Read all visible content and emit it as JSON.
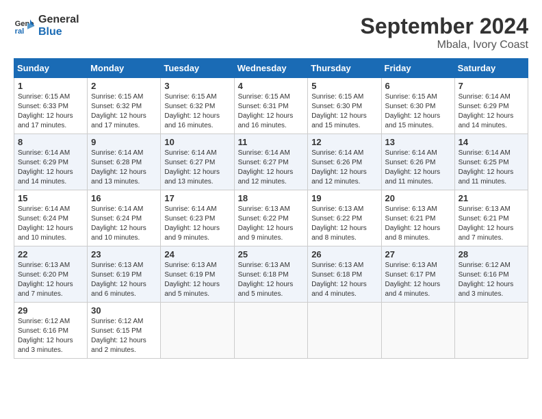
{
  "header": {
    "logo_line1": "General",
    "logo_line2": "Blue",
    "month": "September 2024",
    "location": "Mbala, Ivory Coast"
  },
  "weekdays": [
    "Sunday",
    "Monday",
    "Tuesday",
    "Wednesday",
    "Thursday",
    "Friday",
    "Saturday"
  ],
  "weeks": [
    [
      {
        "day": "1",
        "info": "Sunrise: 6:15 AM\nSunset: 6:33 PM\nDaylight: 12 hours\nand 17 minutes."
      },
      {
        "day": "2",
        "info": "Sunrise: 6:15 AM\nSunset: 6:32 PM\nDaylight: 12 hours\nand 17 minutes."
      },
      {
        "day": "3",
        "info": "Sunrise: 6:15 AM\nSunset: 6:32 PM\nDaylight: 12 hours\nand 16 minutes."
      },
      {
        "day": "4",
        "info": "Sunrise: 6:15 AM\nSunset: 6:31 PM\nDaylight: 12 hours\nand 16 minutes."
      },
      {
        "day": "5",
        "info": "Sunrise: 6:15 AM\nSunset: 6:30 PM\nDaylight: 12 hours\nand 15 minutes."
      },
      {
        "day": "6",
        "info": "Sunrise: 6:15 AM\nSunset: 6:30 PM\nDaylight: 12 hours\nand 15 minutes."
      },
      {
        "day": "7",
        "info": "Sunrise: 6:14 AM\nSunset: 6:29 PM\nDaylight: 12 hours\nand 14 minutes."
      }
    ],
    [
      {
        "day": "8",
        "info": "Sunrise: 6:14 AM\nSunset: 6:29 PM\nDaylight: 12 hours\nand 14 minutes."
      },
      {
        "day": "9",
        "info": "Sunrise: 6:14 AM\nSunset: 6:28 PM\nDaylight: 12 hours\nand 13 minutes."
      },
      {
        "day": "10",
        "info": "Sunrise: 6:14 AM\nSunset: 6:27 PM\nDaylight: 12 hours\nand 13 minutes."
      },
      {
        "day": "11",
        "info": "Sunrise: 6:14 AM\nSunset: 6:27 PM\nDaylight: 12 hours\nand 12 minutes."
      },
      {
        "day": "12",
        "info": "Sunrise: 6:14 AM\nSunset: 6:26 PM\nDaylight: 12 hours\nand 12 minutes."
      },
      {
        "day": "13",
        "info": "Sunrise: 6:14 AM\nSunset: 6:26 PM\nDaylight: 12 hours\nand 11 minutes."
      },
      {
        "day": "14",
        "info": "Sunrise: 6:14 AM\nSunset: 6:25 PM\nDaylight: 12 hours\nand 11 minutes."
      }
    ],
    [
      {
        "day": "15",
        "info": "Sunrise: 6:14 AM\nSunset: 6:24 PM\nDaylight: 12 hours\nand 10 minutes."
      },
      {
        "day": "16",
        "info": "Sunrise: 6:14 AM\nSunset: 6:24 PM\nDaylight: 12 hours\nand 10 minutes."
      },
      {
        "day": "17",
        "info": "Sunrise: 6:14 AM\nSunset: 6:23 PM\nDaylight: 12 hours\nand 9 minutes."
      },
      {
        "day": "18",
        "info": "Sunrise: 6:13 AM\nSunset: 6:22 PM\nDaylight: 12 hours\nand 9 minutes."
      },
      {
        "day": "19",
        "info": "Sunrise: 6:13 AM\nSunset: 6:22 PM\nDaylight: 12 hours\nand 8 minutes."
      },
      {
        "day": "20",
        "info": "Sunrise: 6:13 AM\nSunset: 6:21 PM\nDaylight: 12 hours\nand 8 minutes."
      },
      {
        "day": "21",
        "info": "Sunrise: 6:13 AM\nSunset: 6:21 PM\nDaylight: 12 hours\nand 7 minutes."
      }
    ],
    [
      {
        "day": "22",
        "info": "Sunrise: 6:13 AM\nSunset: 6:20 PM\nDaylight: 12 hours\nand 7 minutes."
      },
      {
        "day": "23",
        "info": "Sunrise: 6:13 AM\nSunset: 6:19 PM\nDaylight: 12 hours\nand 6 minutes."
      },
      {
        "day": "24",
        "info": "Sunrise: 6:13 AM\nSunset: 6:19 PM\nDaylight: 12 hours\nand 5 minutes."
      },
      {
        "day": "25",
        "info": "Sunrise: 6:13 AM\nSunset: 6:18 PM\nDaylight: 12 hours\nand 5 minutes."
      },
      {
        "day": "26",
        "info": "Sunrise: 6:13 AM\nSunset: 6:18 PM\nDaylight: 12 hours\nand 4 minutes."
      },
      {
        "day": "27",
        "info": "Sunrise: 6:13 AM\nSunset: 6:17 PM\nDaylight: 12 hours\nand 4 minutes."
      },
      {
        "day": "28",
        "info": "Sunrise: 6:12 AM\nSunset: 6:16 PM\nDaylight: 12 hours\nand 3 minutes."
      }
    ],
    [
      {
        "day": "29",
        "info": "Sunrise: 6:12 AM\nSunset: 6:16 PM\nDaylight: 12 hours\nand 3 minutes."
      },
      {
        "day": "30",
        "info": "Sunrise: 6:12 AM\nSunset: 6:15 PM\nDaylight: 12 hours\nand 2 minutes."
      },
      null,
      null,
      null,
      null,
      null
    ]
  ]
}
